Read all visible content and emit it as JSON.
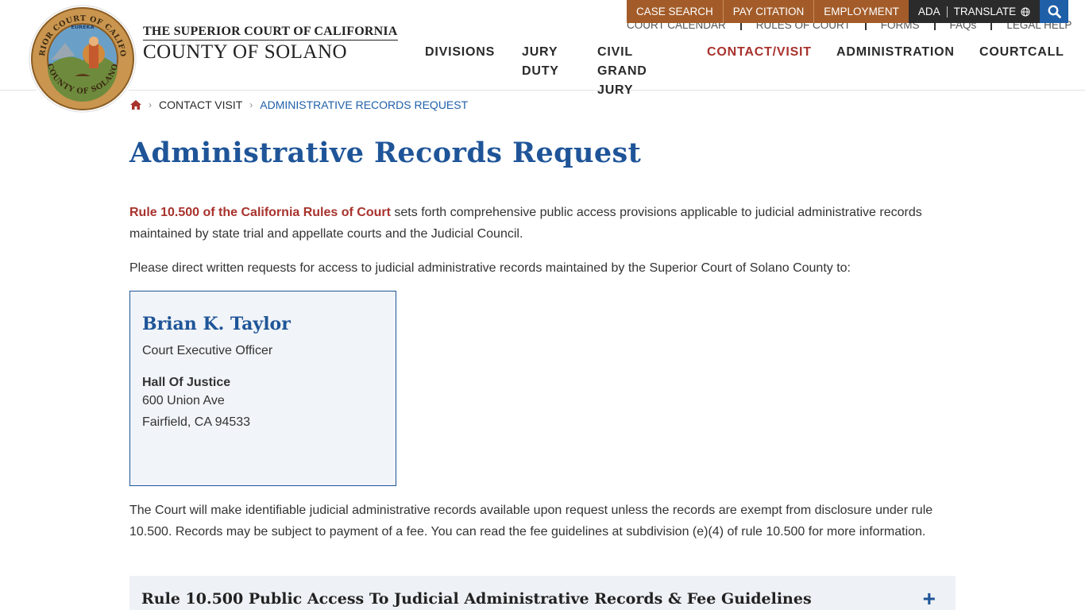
{
  "header": {
    "title_line1": "THE SUPERIOR COURT OF CALIFORNIA",
    "title_line2": "COUNTY OF SOLANO",
    "seal_text_top": "SUPERIOR COURT OF CALIFORNIA",
    "seal_text_bottom": "COUNTY OF SOLANO",
    "seal_motto": "EUREKA",
    "seal_icon": "court-seal-icon"
  },
  "utility": {
    "case_search": "CASE SEARCH",
    "pay_citation": "PAY CITATION",
    "employment": "EMPLOYMENT",
    "ada": "ADA",
    "translate": "TRANSLATE",
    "translate_icon": "globe-icon",
    "search_icon": "search-icon"
  },
  "sub_links": {
    "court_calendar": "COURT CALENDAR",
    "rules_of_court": "RULES OF COURT",
    "forms": "FORMS",
    "faqs": "FAQs",
    "legal_help": "LEGAL HELP"
  },
  "nav": {
    "divisions": "DIVISIONS",
    "jury_duty_1": "JURY",
    "jury_duty_2": "DUTY",
    "civil_grand_jury_1": "CIVIL",
    "civil_grand_jury_2": "GRAND",
    "civil_grand_jury_3": "JURY",
    "contact_visit": "CONTACT/VISIT",
    "administration": "ADMINISTRATION",
    "courtcall": "COURTCALL",
    "active_color": "#a8322d"
  },
  "breadcrumb": {
    "home_icon": "home-icon",
    "contact_visit": "CONTACT VISIT",
    "current": "ADMINISTRATIVE RECORDS REQUEST"
  },
  "page": {
    "title": "Administrative Records Request",
    "intro_link": "Rule 10.500 of the California Rules of Court",
    "intro_text": " sets forth comprehensive public access provisions applicable to judicial administrative records maintained by state trial and appellate courts and the Judicial Council.",
    "direct_text": "Please direct written requests for access to judicial administrative records maintained by the Superior Court of Solano County to:",
    "fee_text": "The Court will make identifiable judicial administrative records available upon request unless the records are exempt from disclosure under rule 10.500. Records may be subject to payment of a fee. You can read the fee guidelines at subdivision (e)(4) of rule 10.500 for more information."
  },
  "contact": {
    "name": "Brian K. Taylor",
    "role": "Court Executive Officer",
    "place": "Hall Of Justice",
    "street": "600 Union Ave",
    "city": "Fairfield, CA 94533"
  },
  "accordion": {
    "title": "Rule 10.500 Public Access To Judicial Administrative Records & Fee Guidelines",
    "toggle": "+"
  },
  "colors": {
    "brand_blue": "#1f5598",
    "accent_red": "#a8322d",
    "utility_brown": "#a35c29"
  }
}
